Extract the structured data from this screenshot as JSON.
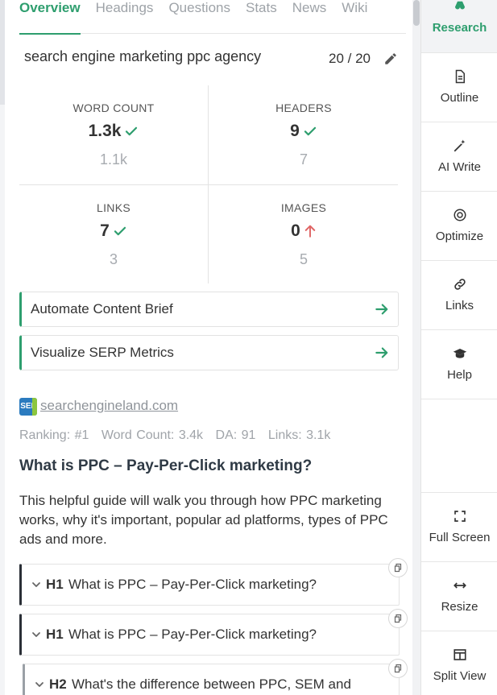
{
  "tabs": [
    {
      "label": "Overview",
      "active": true
    },
    {
      "label": "Headings"
    },
    {
      "label": "Questions"
    },
    {
      "label": "Stats"
    },
    {
      "label": "News"
    },
    {
      "label": "Wiki"
    }
  ],
  "keyword": {
    "text": "search engine marketing ppc agency",
    "count": "20 / 20",
    "icon": "pencil-icon"
  },
  "stats": {
    "word_count": {
      "label": "WORD COUNT",
      "value": "1.3k",
      "target": "1.1k",
      "status": "check"
    },
    "headers": {
      "label": "HEADERS",
      "value": "9",
      "target": "7",
      "status": "check"
    },
    "links": {
      "label": "LINKS",
      "value": "7",
      "target": "3",
      "status": "check"
    },
    "images": {
      "label": "IMAGES",
      "value": "0",
      "target": "5",
      "status": "up-arrow"
    }
  },
  "actions": [
    {
      "label": "Automate Content Brief"
    },
    {
      "label": "Visualize SERP Metrics"
    }
  ],
  "source": {
    "favicon": "SEL",
    "domain": "searchengineland.com",
    "ranking": "Ranking: #1",
    "word_count": "Word Count: 3.4k",
    "da": "DA: 91",
    "links": "Links: 3.1k",
    "title": "What is PPC – Pay-Per-Click marketing?",
    "description": "This helpful guide will walk you through how PPC marketing works, why it's important, popular ad platforms, types of PPC ads and more."
  },
  "headings": [
    {
      "tag": "H1",
      "text": "What is PPC – Pay-Per-Click marketing?"
    },
    {
      "tag": "H1",
      "text": "What is PPC – Pay-Per-Click marketing?"
    },
    {
      "tag": "H2",
      "text": "What's the difference between PPC, SEM and"
    }
  ],
  "sidebar": [
    {
      "label": "Research",
      "icon": "binoculars-icon",
      "active": true
    },
    {
      "label": "Outline",
      "icon": "document-icon"
    },
    {
      "label": "AI Write",
      "icon": "magic-wand-icon"
    },
    {
      "label": "Optimize",
      "icon": "target-icon"
    },
    {
      "label": "Links",
      "icon": "link-icon"
    },
    {
      "label": "Help",
      "icon": "graduation-cap-icon"
    },
    {
      "label": "Full Screen",
      "icon": "fullscreen-icon"
    },
    {
      "label": "Resize",
      "icon": "resize-icon"
    },
    {
      "label": "Split View",
      "icon": "split-view-icon"
    }
  ],
  "colors": {
    "accent": "#2e9e6e",
    "warning": "#e06666",
    "muted": "#a7abb0"
  }
}
